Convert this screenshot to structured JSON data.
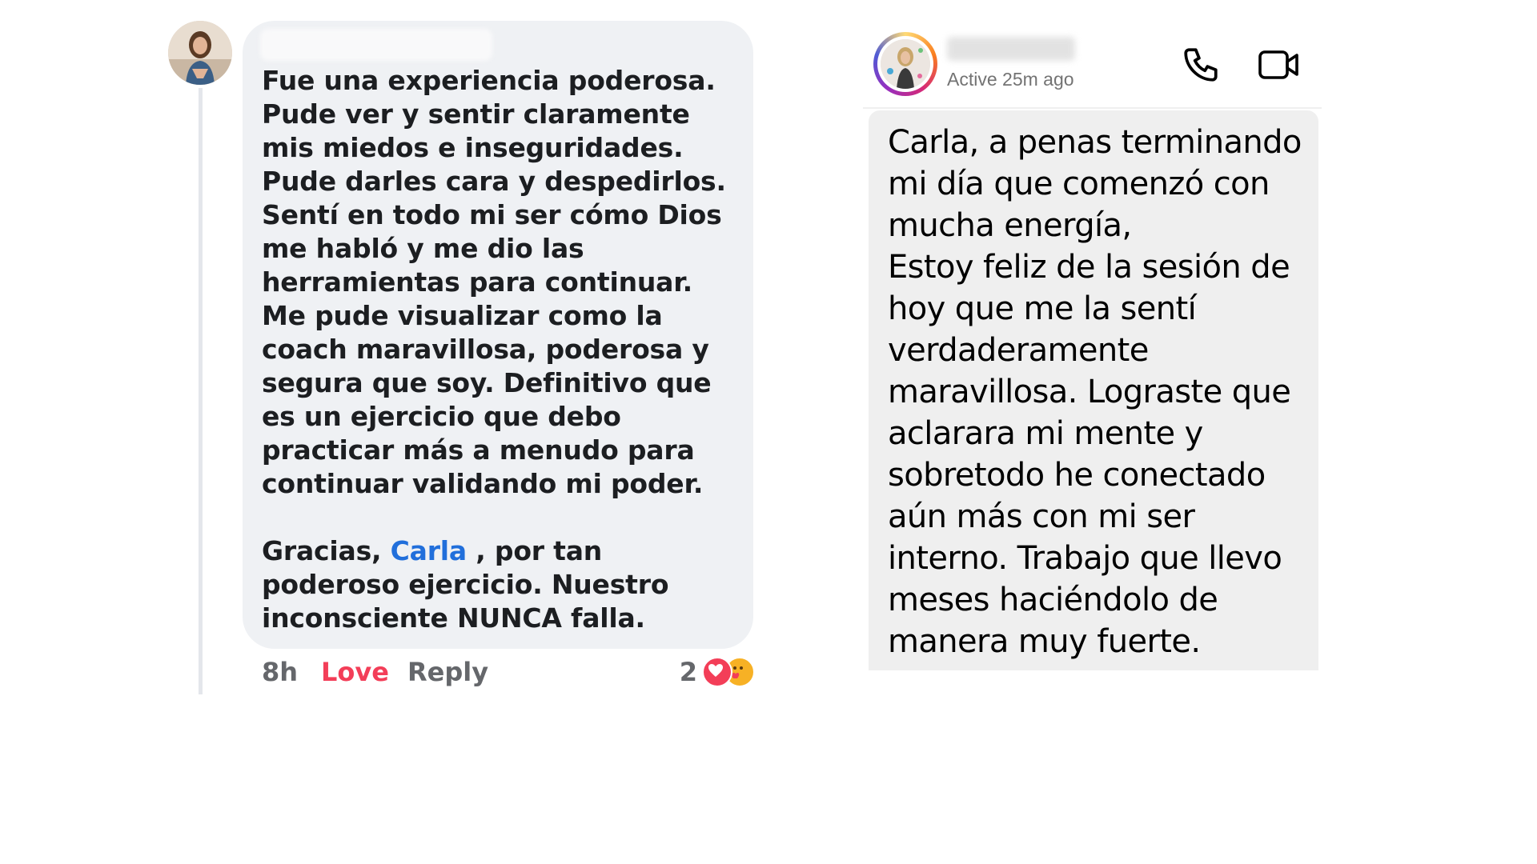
{
  "facebook_comment": {
    "body_paragraphs": [
      "Fue una experiencia poderosa. Pude ver y sentir claramente mis miedos e inseguridades. Pude darles cara y despedirlos. Sentí en todo mi ser cómo Dios me habló y me dio las herramientas para continuar. Me pude visualizar como la coach maravillosa, poderosa y segura que soy. Definitivo que es un ejercicio que debo practicar más a menudo para continuar validando mi poder."
    ],
    "thanks_prefix": "Gracias, ",
    "mention": "Carla",
    "thanks_suffix": " , por tan poderoso ejercicio. Nuestro inconsciente NUNCA falla.",
    "time": "8h",
    "love_label": "Love",
    "reply_label": "Reply",
    "reaction_count": "2",
    "colors": {
      "bubble": "#eff1f4",
      "mention": "#216fdb",
      "love": "#f33e58",
      "meta": "#65676b"
    }
  },
  "instagram_dm": {
    "status": "Active 25m ago",
    "icons": [
      "phone-icon",
      "video-camera-icon"
    ],
    "message_paragraphs": [
      "Carla, a penas terminando mi día que comenzó con mucha energía,",
      "Estoy feliz de la sesión de hoy que me la sentí verdaderamente maravillosa. Lograste que aclarara mi mente y sobretodo he conectado aún más con mi ser interno. Trabajo que llevo meses haciéndolo de manera muy fuerte."
    ],
    "colors": {
      "bubble": "#efefef",
      "status": "#737373"
    }
  }
}
